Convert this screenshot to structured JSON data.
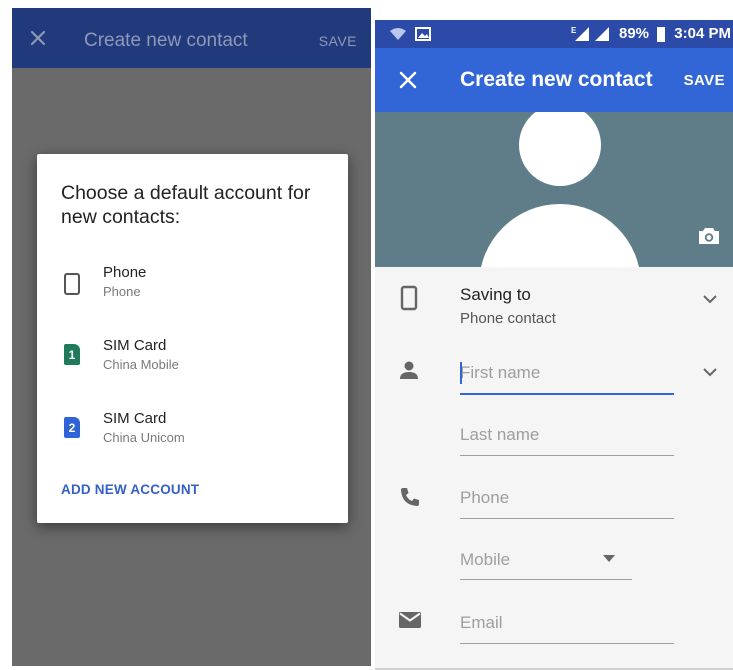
{
  "left": {
    "appbar": {
      "close_icon": "close-icon",
      "title": "Create new contact",
      "save_label": "SAVE"
    },
    "dialog": {
      "heading": "Choose a default account for new contacts:",
      "accounts": [
        {
          "icon": "phone-device-icon",
          "name": "Phone",
          "sub": "Phone"
        },
        {
          "icon": "sim-card-1-icon",
          "badge": "1",
          "badge_color": "#1f7a5c",
          "name": "SIM Card",
          "sub": "China Mobile"
        },
        {
          "icon": "sim-card-2-icon",
          "badge": "2",
          "badge_color": "#2f63d6",
          "name": "SIM Card",
          "sub": "China Unicom"
        }
      ],
      "add_account": "ADD NEW ACCOUNT"
    }
  },
  "right": {
    "status_bar": {
      "battery": "89%",
      "time": "3:04 PM",
      "network_badge": "E"
    },
    "appbar": {
      "title": "Create new contact",
      "save_label": "SAVE"
    },
    "saving_to": {
      "title": "Saving to",
      "value": "Phone contact"
    },
    "fields": {
      "first_name": "First name",
      "last_name": "Last name",
      "phone": "Phone",
      "phone_type": "Mobile",
      "email": "Email"
    }
  },
  "colors": {
    "left_appbar": "#213a7c",
    "right_appbar": "#3266d6",
    "status_bar": "#2c4aa8",
    "photo_bg": "#5f7d89",
    "accent": "#3560c7"
  }
}
